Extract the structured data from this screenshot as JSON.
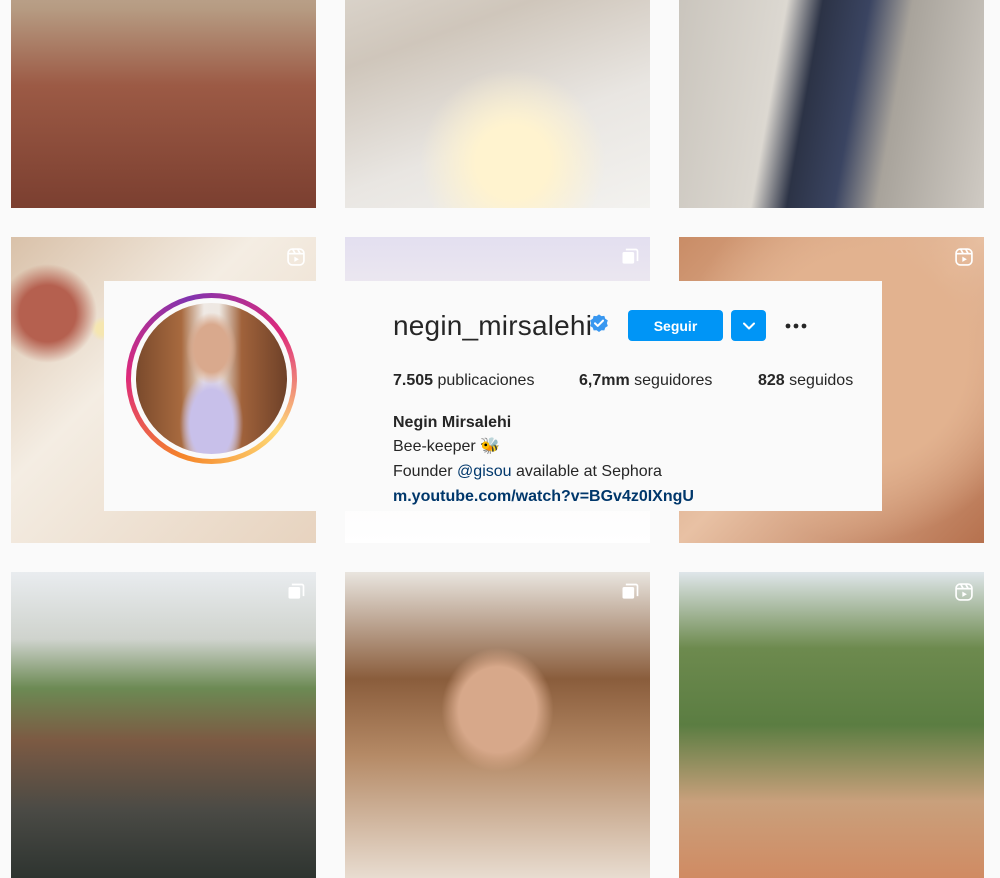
{
  "profile": {
    "username": "negin_mirsalehi",
    "verified": true,
    "follow_label": "Seguir",
    "posts": {
      "count": "7.505",
      "label": "publicaciones"
    },
    "followers": {
      "count": "6,7mm",
      "label": "seguidores"
    },
    "following": {
      "count": "828",
      "label": "seguidos"
    },
    "full_name": "Negin Mirsalehi",
    "bio": {
      "line1": "Bee-keeper",
      "line1_emoji": "🐝",
      "line2_prefix": "Founder",
      "line2_mention": "@gisou",
      "line2_suffix": "available at Sephora",
      "link": "m.youtube.com/watch?v=BGv4z0IXngU"
    }
  },
  "grid": {
    "tiles": [
      {
        "badge": "none"
      },
      {
        "badge": "none"
      },
      {
        "badge": "none"
      },
      {
        "badge": "reels-icon"
      },
      {
        "badge": "carousel-icon"
      },
      {
        "badge": "reels-icon"
      },
      {
        "badge": "carousel-icon"
      },
      {
        "badge": "carousel-icon"
      },
      {
        "badge": "reels-icon"
      }
    ]
  },
  "colors": {
    "primary_button": "#0095f6",
    "link": "#00376b",
    "verified_badge": "#3897f0",
    "text": "#262626",
    "background": "#fafafa"
  }
}
